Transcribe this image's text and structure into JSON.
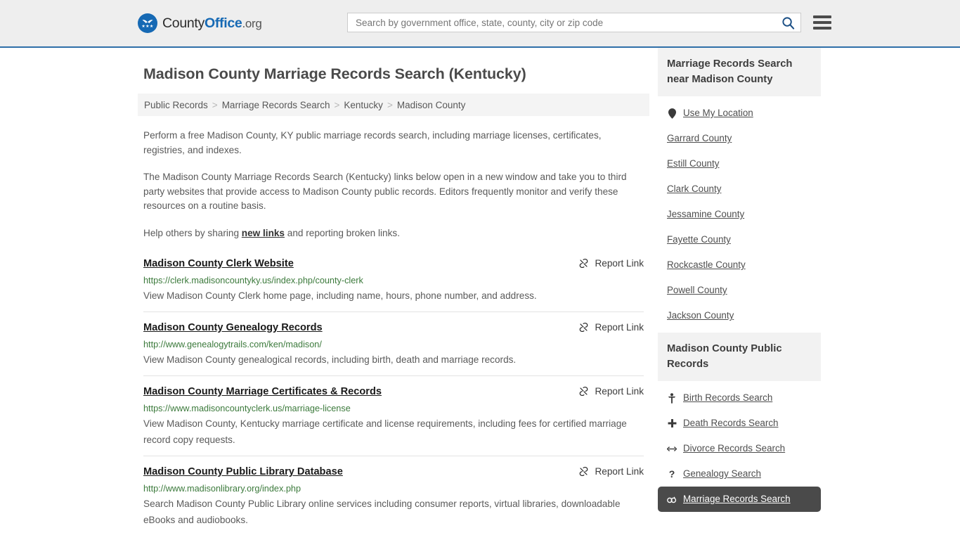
{
  "header": {
    "logo": {
      "part1": "County",
      "part2": "Office",
      "part3": ".org"
    },
    "search": {
      "placeholder": "Search by government office, state, county, city or zip code",
      "value": ""
    }
  },
  "main": {
    "title": "Madison County Marriage Records Search (Kentucky)",
    "breadcrumb": [
      "Public Records",
      "Marriage Records Search",
      "Kentucky",
      "Madison County"
    ],
    "breadcrumb_separator": ">",
    "intro": {
      "p1": "Perform a free Madison County, KY public marriage records search, including marriage licenses, certificates, registries, and indexes.",
      "p2": "The Madison County Marriage Records Search (Kentucky) links below open in a new window and take you to third party websites that provide access to Madison County public records. Editors frequently monitor and verify these resources on a routine basis.",
      "p3_before": "Help others by sharing ",
      "p3_link": "new links",
      "p3_after": " and reporting broken links."
    },
    "report_link_label": "Report Link",
    "results": [
      {
        "title": "Madison County Clerk Website",
        "url": "https://clerk.madisoncountyky.us/index.php/county-clerk",
        "description": "View Madison County Clerk home page, including name, hours, phone number, and address."
      },
      {
        "title": "Madison County Genealogy Records",
        "url": "http://www.genealogytrails.com/ken/madison/",
        "description": "View Madison County genealogical records, including birth, death and marriage records."
      },
      {
        "title": "Madison County Marriage Certificates & Records",
        "url": "https://www.madisoncountyclerk.us/marriage-license",
        "description": "View Madison County, Kentucky marriage certificate and license requirements, including fees for certified marriage record copy requests."
      },
      {
        "title": "Madison County Public Library Database",
        "url": "http://www.madisonlibrary.org/index.php",
        "description": "Search Madison County Public Library online services including consumer reports, virtual libraries, downloadable eBooks and audiobooks."
      }
    ]
  },
  "sidebar": {
    "nearby": {
      "heading": "Marriage Records Search near Madison County",
      "items": [
        {
          "label": "Use My Location",
          "icon": "map-pin-icon"
        },
        {
          "label": "Garrard County",
          "icon": ""
        },
        {
          "label": "Estill County",
          "icon": ""
        },
        {
          "label": "Clark County",
          "icon": ""
        },
        {
          "label": "Jessamine County",
          "icon": ""
        },
        {
          "label": "Fayette County",
          "icon": ""
        },
        {
          "label": "Rockcastle County",
          "icon": ""
        },
        {
          "label": "Powell County",
          "icon": ""
        },
        {
          "label": "Jackson County",
          "icon": ""
        }
      ]
    },
    "public_records": {
      "heading": "Madison County Public Records",
      "items": [
        {
          "label": "Birth Records Search",
          "icon": "baby-icon",
          "glyph": "ὫC",
          "active": false
        },
        {
          "label": "Death Records Search",
          "icon": "cross-icon",
          "glyph": "+",
          "active": false
        },
        {
          "label": "Divorce Records Search",
          "icon": "arrows-split-icon",
          "glyph": "↔",
          "active": false
        },
        {
          "label": "Genealogy Search",
          "icon": "question-mark-icon",
          "glyph": "?",
          "active": false
        },
        {
          "label": "Marriage Records Search",
          "icon": "rings-icon",
          "glyph": "⚭",
          "active": true
        }
      ]
    }
  },
  "colors": {
    "brand_blue": "#1669b4",
    "header_bg": "#eeeeee",
    "url_green": "#3c7a3c",
    "active_bg": "#4a4a4a"
  }
}
